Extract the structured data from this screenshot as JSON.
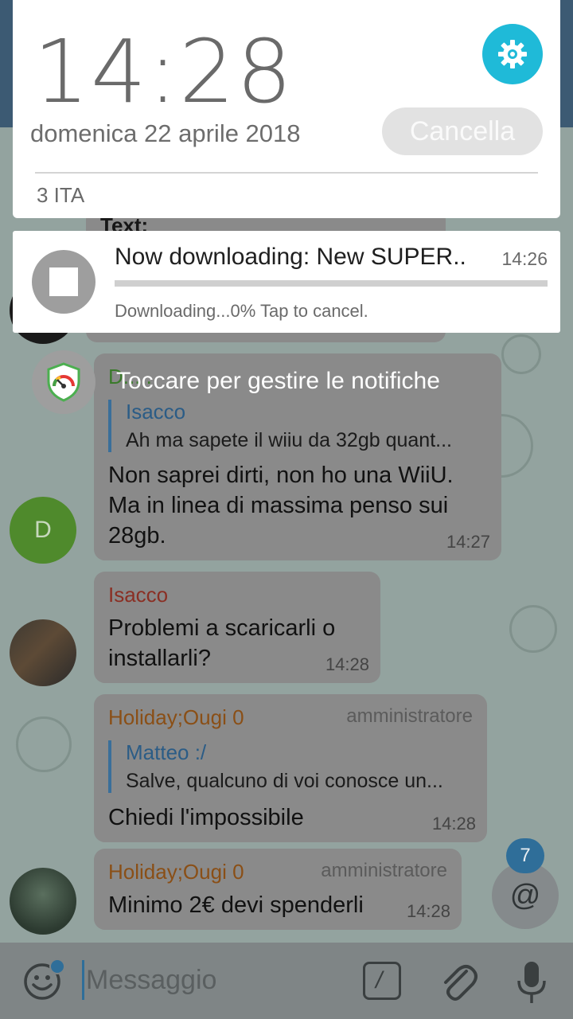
{
  "shade": {
    "time": "14:28",
    "date": "domenica 22 aprile 2018",
    "clear_label": "Cancella",
    "carrier": "3 ITA",
    "settings_icon": "gear-icon",
    "accent_color": "#1fbad8"
  },
  "download": {
    "title": "Now downloading: New SUPER..",
    "time": "14:26",
    "status": "Downloading...0% Tap to cancel.",
    "progress": 0,
    "icon": "stop-icon"
  },
  "manage": {
    "label": "Toccare per gestire le notifiche",
    "icon": "shield-gauge-icon"
  },
  "chat": {
    "partial_text": "Text:",
    "messages": [
      {
        "sender": "D.....",
        "quote_name": "Isacco",
        "quote_text": "Ah ma sapete il wiiu da 32gb quant...",
        "text": "Non saprei dirti, non ho una WiiU. Ma in linea di massima penso sui 28gb.",
        "time": "14:27",
        "avatar_letter": "D"
      },
      {
        "sender": "Isacco",
        "text": "Problemi a scaricarli o installarli?",
        "time": "14:28"
      },
      {
        "sender": "Holiday;Ougi 0",
        "role": "amministratore",
        "quote_name": "Matteo :/",
        "quote_text": "Salve, qualcuno di voi conosce un...",
        "text": "Chiedi l'impossibile",
        "time": "14:28"
      },
      {
        "sender": "Holiday;Ougi 0",
        "role": "amministratore",
        "text": "Minimo 2€ devi spenderli",
        "time": "14:28"
      }
    ],
    "mention_count": "7",
    "mention_symbol": "@"
  },
  "composer": {
    "placeholder": "Messaggio",
    "command_symbol": "/"
  }
}
